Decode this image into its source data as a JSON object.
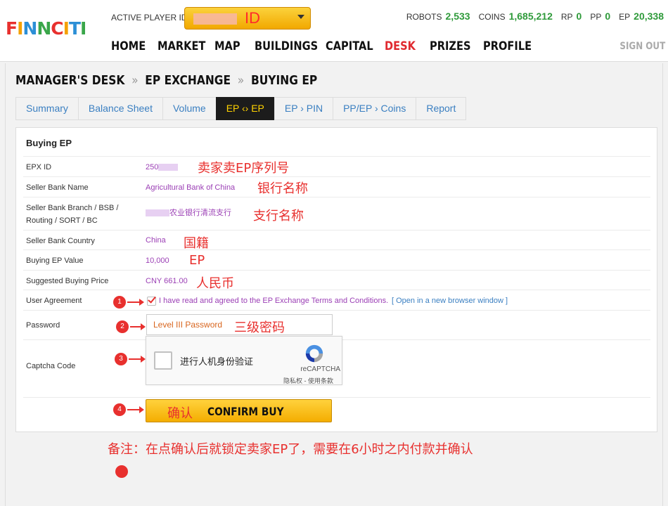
{
  "header": {
    "logo": "FINNCITI",
    "player_label": "ACTIVE PLAYER ID",
    "player_value_annotation": "ID",
    "stats": [
      {
        "label": "ROBOTS",
        "value": "2,533"
      },
      {
        "label": "COINS",
        "value": "1,685,212"
      },
      {
        "label": "RP",
        "value": "0"
      },
      {
        "label": "PP",
        "value": "0"
      },
      {
        "label": "EP",
        "value": "20,338"
      }
    ],
    "nav": [
      "HOME",
      "MARKET",
      "MAP",
      "BUILDINGS",
      "CAPITAL",
      "DESK",
      "PRIZES",
      "PROFILE"
    ],
    "nav_active": "DESK",
    "signout": "SIGN OUT"
  },
  "breadcrumb": {
    "items": [
      "MANAGER'S DESK",
      "EP EXCHANGE",
      "BUYING EP"
    ],
    "separator": "»"
  },
  "tabs": [
    {
      "label": "Summary",
      "active": false
    },
    {
      "label": "Balance Sheet",
      "active": false
    },
    {
      "label": "Volume",
      "active": false
    },
    {
      "label": "EP ‹› EP",
      "active": true
    },
    {
      "label": "EP › PIN",
      "active": false
    },
    {
      "label": "PP/EP › Coins",
      "active": false
    },
    {
      "label": "Report",
      "active": false
    }
  ],
  "form": {
    "title": "Buying EP",
    "epx_id": {
      "label": "EPX ID",
      "value": "250",
      "annotation": "卖家卖EP序列号"
    },
    "bank_name": {
      "label": "Seller Bank Name",
      "value": "Agricultural Bank of China",
      "annotation": "银行名称"
    },
    "bank_branch": {
      "label_line1": "Seller Bank Branch / BSB /",
      "label_line2": "Routing / SORT / BC",
      "value": "农业银行清流支行",
      "annotation": "支行名称"
    },
    "bank_country": {
      "label": "Seller Bank Country",
      "value": "China",
      "annotation": "国籍"
    },
    "ep_value": {
      "label": "Buying EP Value",
      "value": "10,000",
      "annotation": "EP"
    },
    "price": {
      "label": "Suggested Buying Price",
      "value": "CNY 661.00",
      "annotation": "人民币"
    },
    "agreement": {
      "label": "User Agreement",
      "text": "I have read and agreed to the EP Exchange Terms and Conditions.",
      "link": "[ Open in a new browser window ]",
      "checked": true,
      "step": "1"
    },
    "password": {
      "label": "Password",
      "placeholder": "Level III Password",
      "annotation": "三级密码",
      "step": "2"
    },
    "captcha": {
      "label": "Captcha Code",
      "checkbox_text": "进行人机身份验证",
      "brand": "reCAPTCHA",
      "links": "隐私权 - 使用条款",
      "step": "3"
    },
    "confirm": {
      "label": "CONFIRM BUY",
      "annotation": "确认",
      "step": "4"
    }
  },
  "footer_note": "备注：在点确认后就锁定卖家EP了，需要在6小时之内付款并确认",
  "colors": {
    "accent_yellow": "#f4ad00",
    "annotation_red": "#e8302e",
    "value_purple": "#9b3fb5",
    "tab_blue": "#3a7fc1",
    "stat_green": "#2e9a3a",
    "nav_active_red": "#e0292f"
  }
}
